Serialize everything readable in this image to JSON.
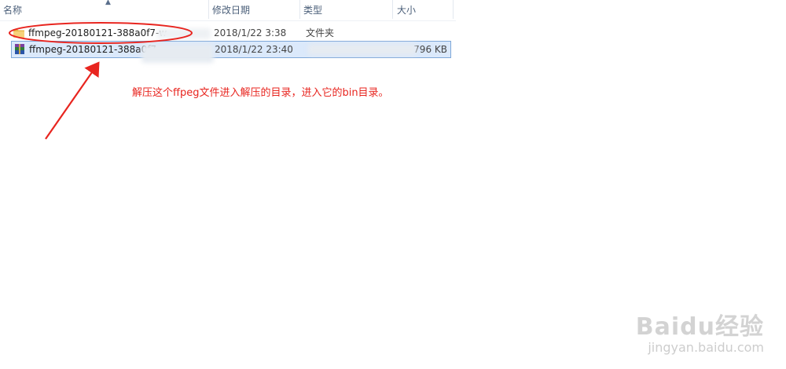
{
  "columns": {
    "name": "名称",
    "date": "修改日期",
    "type": "类型",
    "size": "大小"
  },
  "files": [
    {
      "name": "ffmpeg-20180121-388a0f7-w",
      "date": "2018/1/22 3:38",
      "type": "文件夹",
      "size": "",
      "icon": "folder-icon"
    },
    {
      "name": "ffmpeg-20180121-388a0f7",
      "date": "2018/1/22 23:40",
      "type": "",
      "size": "796 KB",
      "icon": "winrar-archive-icon"
    }
  ],
  "annotation": {
    "text": "解压这个ffpeg文件进入解压的目录，进入它的bin目录。",
    "color": "#e8251f"
  },
  "watermark": {
    "brand": "Baidu经验",
    "site": "jingyan.baidu.com"
  }
}
